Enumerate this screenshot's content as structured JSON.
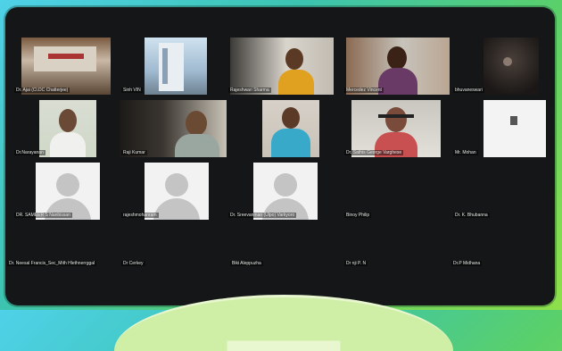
{
  "participants": [
    {
      "name": "Dr. Ajai (Cl.DC Chatterjee)",
      "style": "video"
    },
    {
      "name": "Sinh VIN",
      "style": "video"
    },
    {
      "name": "Rajeshwari Sharma",
      "style": "video"
    },
    {
      "name": "Mercedez Vincent",
      "style": "video"
    },
    {
      "name": "bhuvaneswari",
      "style": "video"
    },
    {
      "name": "Dr.Narayanan",
      "style": "video"
    },
    {
      "name": "Raji Kumar",
      "style": "video"
    },
    {
      "name": "",
      "style": "video"
    },
    {
      "name": "Dr. Sathis George Varghese",
      "style": "video"
    },
    {
      "name": "Mr. Mohan",
      "style": "video"
    },
    {
      "name": "DR. SAMEER S Nanbissan",
      "style": "placeholder"
    },
    {
      "name": "rajeshmohanram",
      "style": "placeholder"
    },
    {
      "name": "Dr. Sreevanman (Ulpo) Varkyoro",
      "style": "placeholder"
    },
    {
      "name": "Binoy Philip",
      "style": "empty"
    },
    {
      "name": "Dr. K. Bhubanna",
      "style": "empty"
    },
    {
      "name": "Dr. Neesal Francis_Sec_Mith Hlethnerrggal",
      "style": "empty"
    },
    {
      "name": "Dr Cerkey",
      "style": "empty"
    },
    {
      "name": "Biki Aleppuzha",
      "style": "empty"
    },
    {
      "name": "Dr nji P. N",
      "style": "empty"
    },
    {
      "name": "Dr.P Midhana",
      "style": "empty"
    }
  ],
  "colors": {
    "meeting_background": "#151617",
    "placeholder_background": "#f2f2f2",
    "avatar_grey": "#c4c4c4"
  }
}
